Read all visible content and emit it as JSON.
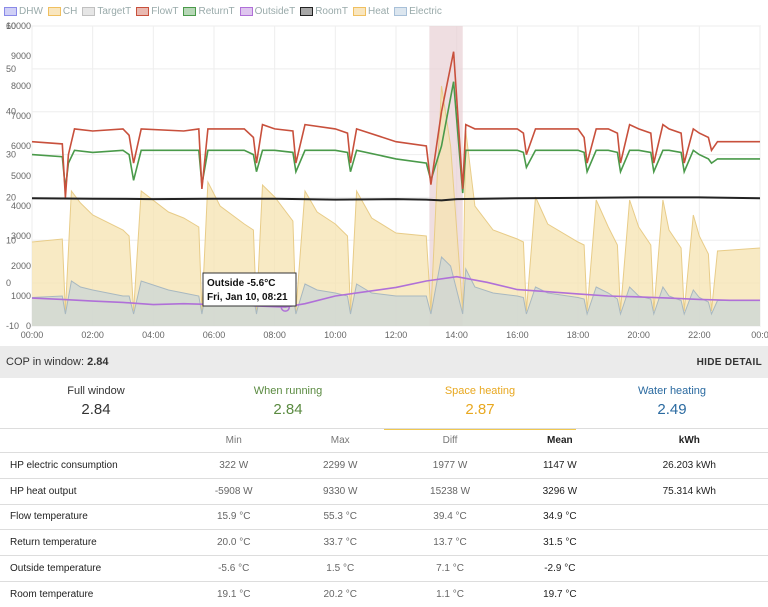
{
  "legend": [
    {
      "label": "DHW",
      "color": "#8a8ae8"
    },
    {
      "label": "CH",
      "color": "#f0c060"
    },
    {
      "label": "TargetT",
      "color": "#c0c0c0"
    },
    {
      "label": "FlowT",
      "color": "#c8503c"
    },
    {
      "label": "ReturnT",
      "color": "#4a9a4a"
    },
    {
      "label": "OutsideT",
      "color": "#b070d8"
    },
    {
      "label": "RoomT",
      "color": "#222222"
    },
    {
      "label": "Heat",
      "color": "#f0c060"
    },
    {
      "label": "Electric",
      "color": "#a8c0d8"
    }
  ],
  "tooltip": {
    "line1": "Outside -5.6°C",
    "line2": "Fri, Jan 10, 08:21"
  },
  "chart_data": {
    "type": "line",
    "title": "",
    "x_ticks": [
      "00:00",
      "02:00",
      "04:00",
      "06:00",
      "08:00",
      "10:00",
      "12:00",
      "14:00",
      "16:00",
      "18:00",
      "20:00",
      "22:00",
      "00:0"
    ],
    "y_left_ticks": [
      "60",
      "50",
      "40",
      "30",
      "20",
      "10",
      "0",
      "-10"
    ],
    "y_right_ticks": [
      "10000",
      "9000",
      "8000",
      "7000",
      "6000",
      "5000",
      "4000",
      "3000",
      "2000",
      "1000",
      "0"
    ],
    "y_left_range": [
      -10,
      60
    ],
    "y_right_range": [
      0,
      10000
    ],
    "x_range_hours": [
      0,
      24
    ],
    "highlight_hours": [
      13.1,
      14.2
    ],
    "series": [
      {
        "name": "FlowT",
        "axis": "left",
        "color": "#c8503c",
        "x": [
          0,
          1,
          1.1,
          1.2,
          1.4,
          2,
          3,
          3.2,
          3.35,
          3.6,
          5,
          5.5,
          5.6,
          5.8,
          7,
          7.3,
          7.4,
          7.6,
          8,
          8.6,
          8.7,
          9,
          10,
          10.4,
          10.5,
          10.7,
          12,
          13,
          13.15,
          13.5,
          13.9,
          14.2,
          14.3,
          14.6,
          16,
          16.2,
          16.3,
          16.6,
          18,
          18.2,
          18.3,
          18.6,
          19,
          19.3,
          19.4,
          19.7,
          20,
          20.4,
          20.5,
          20.8,
          21,
          21.4,
          21.5,
          21.8,
          22,
          22.3,
          22.4,
          22.6,
          24
        ],
        "y": [
          33,
          32.5,
          20,
          30,
          36,
          35.5,
          36,
          34.5,
          28,
          36,
          35.5,
          36,
          22,
          36,
          36,
          34,
          28,
          37,
          36,
          35.5,
          28,
          37,
          36,
          35,
          28,
          36,
          33,
          32,
          23,
          40,
          54,
          22,
          37,
          36,
          36,
          35,
          30,
          36,
          36,
          34,
          28,
          36,
          36,
          35,
          28,
          37,
          36,
          35,
          28,
          37,
          36,
          35,
          28,
          36,
          35,
          34,
          31,
          33,
          33
        ]
      },
      {
        "name": "ReturnT",
        "axis": "left",
        "color": "#4a9a4a",
        "x": [
          0,
          1,
          1.1,
          1.2,
          1.4,
          2,
          3,
          3.2,
          3.35,
          3.6,
          5,
          5.5,
          5.6,
          5.8,
          7,
          7.3,
          7.4,
          7.6,
          8,
          8.6,
          8.7,
          9,
          10,
          10.4,
          10.5,
          10.7,
          12,
          13,
          13.15,
          13.5,
          13.9,
          14.2,
          14.3,
          14.6,
          16,
          16.2,
          16.3,
          16.6,
          18,
          18.2,
          18.3,
          18.6,
          19,
          19.3,
          19.4,
          19.7,
          20,
          20.4,
          20.5,
          20.8,
          21,
          21.4,
          21.5,
          21.8,
          22,
          22.3,
          22.4,
          22.6,
          24
        ],
        "y": [
          30,
          29.5,
          22,
          28,
          31,
          30.5,
          31,
          30,
          24,
          31,
          31,
          31,
          23,
          31,
          31,
          30,
          26,
          31,
          31,
          30.5,
          26,
          31,
          31,
          30.5,
          26,
          31,
          29,
          28,
          24,
          32,
          47,
          21,
          31,
          31,
          31,
          30.5,
          27,
          31,
          31,
          30.5,
          26,
          31,
          31,
          30.5,
          26,
          31,
          31,
          30.5,
          26,
          31,
          31,
          30.5,
          26,
          31,
          30,
          29,
          28,
          29,
          29
        ]
      },
      {
        "name": "RoomT",
        "axis": "left",
        "color": "#222222",
        "x": [
          0,
          2,
          4,
          6,
          8,
          10,
          12,
          13,
          13.5,
          14,
          16,
          18,
          20,
          22,
          24
        ],
        "y": [
          19.8,
          19.7,
          19.6,
          19.7,
          19.7,
          19.5,
          19.6,
          19.5,
          19.3,
          19.6,
          19.8,
          19.9,
          20.0,
          20.0,
          19.8
        ]
      },
      {
        "name": "OutsideT",
        "axis": "left",
        "color": "#b070d8",
        "x": [
          0,
          1,
          2,
          3,
          4,
          5,
          6,
          7,
          8,
          8.35,
          9,
          10,
          11,
          12,
          13,
          14,
          15,
          16,
          17,
          18,
          19,
          20,
          21,
          22,
          23,
          24
        ],
        "y": [
          -3.5,
          -3.8,
          -4.2,
          -4.5,
          -5.0,
          -4.8,
          -5.0,
          -5.2,
          -5.5,
          -5.6,
          -4.8,
          -3.0,
          -2.0,
          -1.0,
          0.5,
          1.5,
          0.2,
          -1.5,
          -2.0,
          -2.5,
          -3.0,
          -3.2,
          -3.5,
          -3.8,
          -4.0,
          -4.0
        ]
      },
      {
        "name": "Heat",
        "axis": "right",
        "color": "#f0c060",
        "x": [
          0,
          1,
          1.1,
          1.3,
          1.6,
          2,
          3,
          3.2,
          3.35,
          3.6,
          4.5,
          5,
          5.5,
          5.6,
          5.8,
          6.2,
          7,
          7.3,
          7.4,
          7.6,
          8,
          8.6,
          8.7,
          9,
          9.4,
          10,
          10.4,
          10.5,
          10.7,
          11.2,
          12,
          13,
          13.15,
          13.5,
          13.8,
          14.2,
          14.3,
          14.6,
          15.2,
          16,
          16.2,
          16.3,
          16.6,
          17,
          18,
          18.2,
          18.3,
          18.6,
          19,
          19.3,
          19.4,
          19.7,
          20,
          20.4,
          20.5,
          20.8,
          21,
          21.4,
          21.5,
          21.8,
          22,
          22.3,
          22.4,
          22.6,
          24
        ],
        "y": [
          2800,
          2900,
          500,
          4500,
          4100,
          3700,
          3200,
          3000,
          500,
          4500,
          3800,
          3600,
          3300,
          500,
          4800,
          4000,
          3400,
          3200,
          500,
          4700,
          4300,
          3500,
          500,
          4500,
          3800,
          3400,
          3000,
          500,
          4500,
          3600,
          3100,
          3000,
          500,
          8000,
          6000,
          500,
          6500,
          4000,
          3200,
          2900,
          2800,
          500,
          4300,
          3400,
          2800,
          2700,
          500,
          4200,
          3300,
          2700,
          500,
          4200,
          3300,
          2700,
          500,
          4200,
          3200,
          2600,
          500,
          3700,
          3000,
          2400,
          500,
          2500,
          2600
        ]
      },
      {
        "name": "Electric",
        "axis": "right",
        "color": "#a8c0d8",
        "x": [
          0,
          1,
          1.1,
          1.3,
          1.6,
          2,
          3,
          3.2,
          3.35,
          3.6,
          4.5,
          5,
          5.5,
          5.6,
          5.8,
          6.2,
          7,
          7.3,
          7.4,
          7.6,
          8,
          8.6,
          8.7,
          9,
          9.4,
          10,
          10.4,
          10.5,
          10.7,
          11.2,
          12,
          13,
          13.15,
          13.5,
          13.8,
          14.2,
          14.3,
          14.6,
          15.2,
          16,
          16.2,
          16.3,
          16.6,
          17,
          18,
          18.2,
          18.3,
          18.6,
          19,
          19.3,
          19.4,
          19.7,
          20,
          20.4,
          20.5,
          20.8,
          21,
          21.4,
          21.5,
          21.8,
          22,
          22.3,
          22.4,
          22.6,
          24
        ],
        "y": [
          950,
          1000,
          400,
          1500,
          1300,
          1200,
          1000,
          1000,
          400,
          1500,
          1200,
          1100,
          1000,
          400,
          1500,
          1300,
          1100,
          1000,
          400,
          1500,
          1300,
          1100,
          400,
          1400,
          1200,
          1100,
          1000,
          400,
          1400,
          1100,
          1000,
          1000,
          400,
          2300,
          2000,
          400,
          1900,
          1300,
          1100,
          1000,
          950,
          400,
          1300,
          1100,
          950,
          900,
          400,
          1300,
          1100,
          900,
          400,
          1300,
          1000,
          900,
          400,
          1300,
          1000,
          850,
          400,
          1200,
          950,
          800,
          400,
          850,
          850
        ]
      }
    ]
  },
  "cop_bar": {
    "label": "COP in window:",
    "value": "2.84",
    "button": "HIDE DETAIL"
  },
  "summary": [
    {
      "label": "Full window",
      "value": "2.84",
      "color": "#333333"
    },
    {
      "label": "When running",
      "value": "2.84",
      "color": "#5a8a40"
    },
    {
      "label": "Space heating",
      "value": "2.87",
      "color": "#e8a820"
    },
    {
      "label": "Water heating",
      "value": "2.49",
      "color": "#2a6aa0"
    }
  ],
  "stats_headers": [
    "",
    "Min",
    "Max",
    "Diff",
    "Mean",
    "kWh"
  ],
  "stats_rows": [
    {
      "name": "HP electric consumption",
      "min": "322 W",
      "max": "2299 W",
      "diff": "1977 W",
      "mean": "1147 W",
      "kwh": "26.203 kWh"
    },
    {
      "name": "HP heat output",
      "min": "-5908 W",
      "max": "9330 W",
      "diff": "15238 W",
      "mean": "3296 W",
      "kwh": "75.314 kWh"
    },
    {
      "name": "Flow temperature",
      "min": "15.9 °C",
      "max": "55.3 °C",
      "diff": "39.4 °C",
      "mean": "34.9 °C",
      "kwh": ""
    },
    {
      "name": "Return temperature",
      "min": "20.0 °C",
      "max": "33.7 °C",
      "diff": "13.7 °C",
      "mean": "31.5 °C",
      "kwh": ""
    },
    {
      "name": "Outside temperature",
      "min": "-5.6 °C",
      "max": "1.5 °C",
      "diff": "7.1 °C",
      "mean": "-2.9 °C",
      "kwh": ""
    },
    {
      "name": "Room temperature",
      "min": "19.1 °C",
      "max": "20.2 °C",
      "diff": "1.1 °C",
      "mean": "19.7 °C",
      "kwh": ""
    }
  ]
}
